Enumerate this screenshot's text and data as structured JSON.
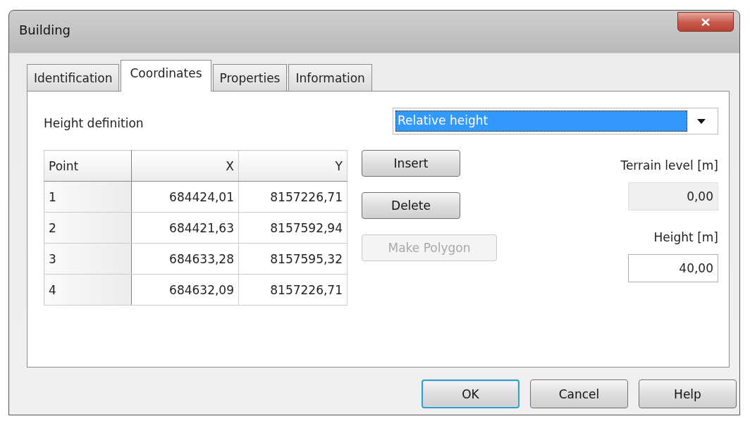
{
  "window": {
    "title": "Building"
  },
  "tabs": [
    {
      "label": "Identification",
      "selected": false
    },
    {
      "label": "Coordinates",
      "selected": true
    },
    {
      "label": "Properties",
      "selected": false
    },
    {
      "label": "Information",
      "selected": false
    }
  ],
  "height_definition": {
    "label": "Height definition",
    "value": "Relative height"
  },
  "table": {
    "columns": [
      "Point",
      "X",
      "Y"
    ],
    "rows": [
      [
        "1",
        "684424,01",
        "8157226,71"
      ],
      [
        "2",
        "684421,63",
        "8157592,94"
      ],
      [
        "3",
        "684633,28",
        "8157595,32"
      ],
      [
        "4",
        "684632,09",
        "8157226,71"
      ]
    ]
  },
  "side_buttons": [
    {
      "label": "Insert",
      "disabled": false
    },
    {
      "label": "Delete",
      "disabled": false
    },
    {
      "label": "Make Polygon",
      "disabled": true
    }
  ],
  "terrain_level": {
    "label": "Terrain level [m]",
    "value": "0,00",
    "disabled": true
  },
  "height": {
    "label": "Height [m]",
    "value": "40,00",
    "disabled": false
  },
  "buttons": [
    {
      "label": "OK",
      "default": true
    },
    {
      "label": "Cancel",
      "default": false
    },
    {
      "label": "Help",
      "default": false
    }
  ]
}
